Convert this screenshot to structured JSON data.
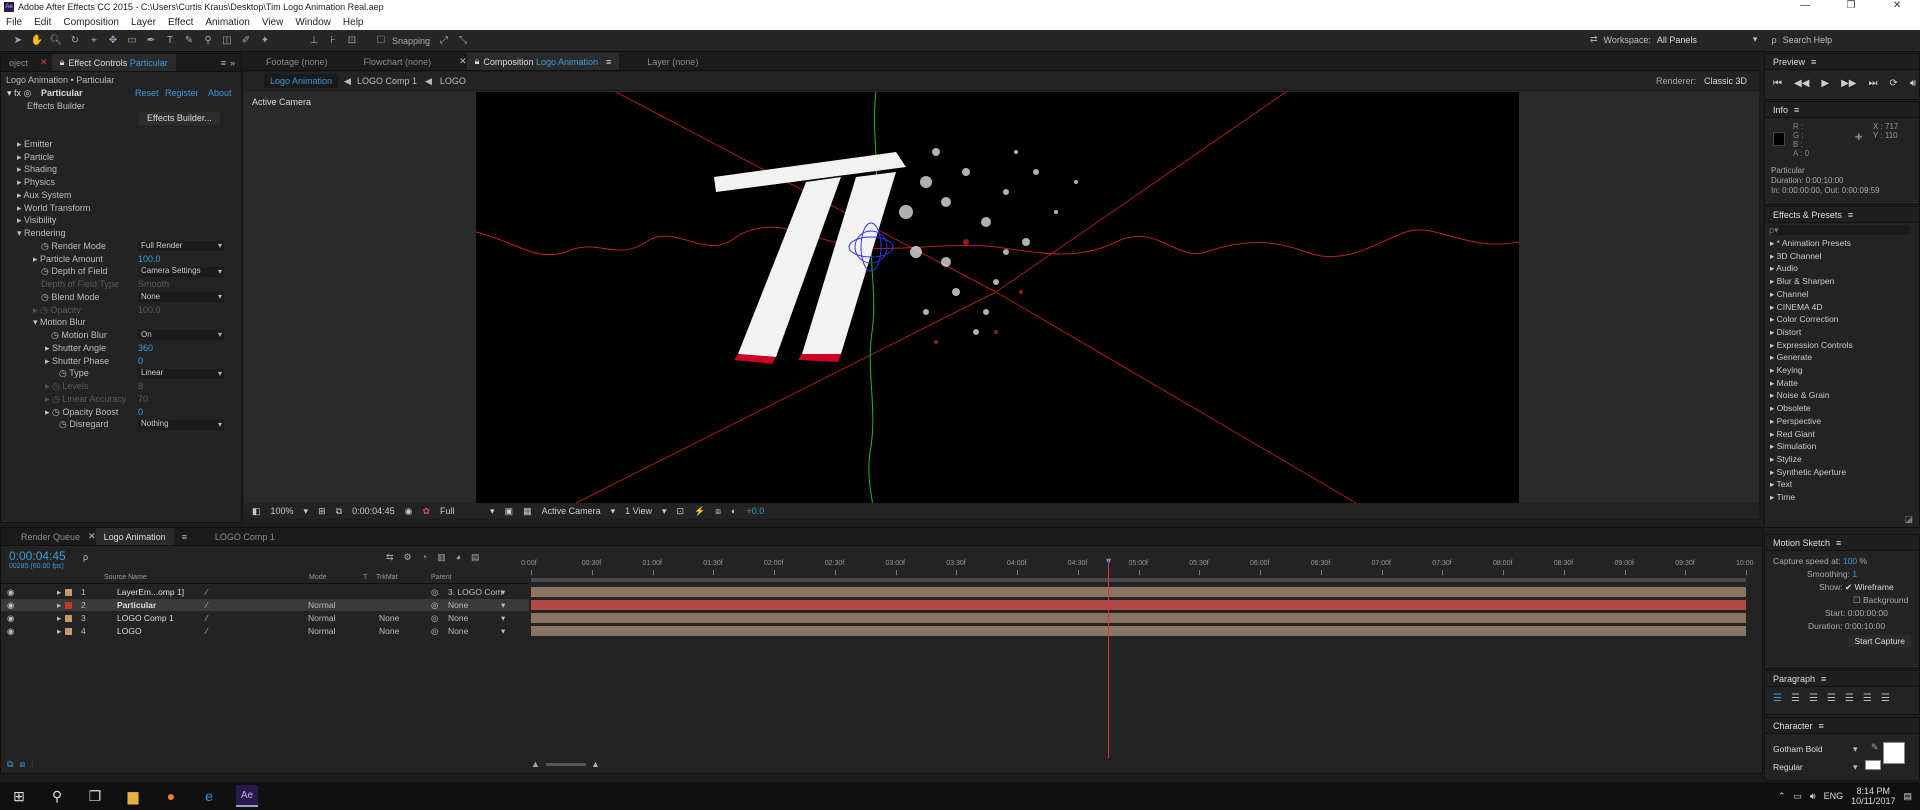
{
  "window": {
    "title": "Adobe After Effects CC 2015 - C:\\Users\\Curtis Kraus\\Desktop\\Tim Logo Animation Real.aep",
    "min": "—",
    "max": "❐",
    "close": "✕"
  },
  "menu": [
    "File",
    "Edit",
    "Composition",
    "Layer",
    "Effect",
    "Animation",
    "View",
    "Window",
    "Help"
  ],
  "toolbar": {
    "snapping": "Snapping",
    "workspace_label": "Workspace:",
    "workspace_value": "All Panels",
    "search_help": "Search Help"
  },
  "effect_controls": {
    "tabs": [
      "oject",
      "Effect Controls",
      "Particular"
    ],
    "breadcrumb": "Logo Animation • Particular",
    "effect_name": "Particular",
    "reset": "Reset",
    "register": "Register",
    "about": "About",
    "effects_builder_label": "Effects Builder",
    "effects_builder_btn": "Effects Builder...",
    "groups": [
      "Emitter",
      "Particle",
      "Shading",
      "Physics",
      "Aux System",
      "World Transform",
      "Visibility",
      "Rendering"
    ],
    "props": [
      {
        "label": "Render Mode",
        "value": "Full Render",
        "dd": true
      },
      {
        "label": "Particle Amount",
        "value": "100.0"
      },
      {
        "label": "Depth of Field",
        "value": "Camera Settings",
        "dd": true
      },
      {
        "label": "Depth of Field Type",
        "value": "Smooth",
        "dim": true
      },
      {
        "label": "Blend Mode",
        "value": "None",
        "dd": true
      },
      {
        "label": "Opacity",
        "value": "100.0",
        "dim": true
      },
      {
        "label": "Motion Blur",
        "value": ""
      },
      {
        "label": "Motion Blur",
        "value": "On",
        "dd": true
      },
      {
        "label": "Shutter Angle",
        "value": "360"
      },
      {
        "label": "Shutter Phase",
        "value": "0"
      },
      {
        "label": "Type",
        "value": "Linear",
        "dd": true
      },
      {
        "label": "Levels",
        "value": "8",
        "dim": true
      },
      {
        "label": "Linear Accuracy",
        "value": "70",
        "dim": true
      },
      {
        "label": "Opacity Boost",
        "value": "0"
      },
      {
        "label": "Disregard",
        "value": "Nothing",
        "dd": true
      }
    ]
  },
  "viewer_tabs": {
    "footage": "Footage (none)",
    "flowchart": "Flowchart (none)",
    "composition": "Composition",
    "composition_name": "Logo Animation",
    "layer": "Layer (none)"
  },
  "viewer": {
    "crumbs": [
      "Logo Animation",
      "LOGO Comp 1",
      "LOGO"
    ],
    "renderer_label": "Renderer:",
    "renderer_value": "Classic 3D",
    "active_camera": "Active Camera",
    "bottom": {
      "zoom": "100%",
      "time": "0:00:04:45",
      "resolution": "Full",
      "camera": "Active Camera",
      "views": "1 View",
      "exposure": "+0.0"
    }
  },
  "timeline": {
    "tabs": [
      "Render Queue",
      "Logo Animation",
      "LOGO Comp 1"
    ],
    "timecode": "0:00:04:45",
    "frame": "00285 (60.00 fps)",
    "headers": {
      "source": "Source Name",
      "mode": "Mode",
      "t": "T",
      "trkmat": "TrkMat",
      "parent": "Parent"
    },
    "ticks": [
      "0:00f",
      "00:30f",
      "01:00f",
      "01:30f",
      "02:00f",
      "02:30f",
      "03:00f",
      "03:30f",
      "04:00f",
      "04:30f",
      "05:00f",
      "05:30f",
      "06:00f",
      "06:30f",
      "07:00f",
      "07:30f",
      "08:00f",
      "08:30f",
      "09:00f",
      "09:30f",
      "10:00"
    ],
    "playhead_fraction": 0.475,
    "layers": [
      {
        "num": "1",
        "name": "LayerEm...omp 1]",
        "mode": "",
        "trkmat": "",
        "parent": "3. LOGO Com",
        "color": "#c49a6c"
      },
      {
        "num": "2",
        "name": "Particular",
        "mode": "Normal",
        "trkmat": "",
        "parent": "None",
        "color": "#c0392b"
      },
      {
        "num": "3",
        "name": "LOGO Comp 1",
        "mode": "Normal",
        "trkmat": "None",
        "parent": "None",
        "color": "#c49a6c"
      },
      {
        "num": "4",
        "name": "LOGO",
        "mode": "Normal",
        "trkmat": "None",
        "parent": "None",
        "color": "#c49a6c"
      }
    ]
  },
  "preview": {
    "title": "Preview"
  },
  "info": {
    "title": "Info",
    "r": "R :",
    "g": "G :",
    "b": "B :",
    "a": "A : 0",
    "x": "X : 717",
    "y": "Y : 110",
    "layer": "Particular",
    "duration": "Duration: 0:00:10:00",
    "inout": "In: 0:00:00:00, Out: 0:00:09:59"
  },
  "effects_presets": {
    "title": "Effects & Presets",
    "search_placeholder": "ρ▾",
    "items": [
      "* Animation Presets",
      "3D Channel",
      "Audio",
      "Blur & Sharpen",
      "Channel",
      "CINEMA 4D",
      "Color Correction",
      "Distort",
      "Expression Controls",
      "Generate",
      "Keying",
      "Matte",
      "Noise & Grain",
      "Obsolete",
      "Perspective",
      "Red Giant",
      "Simulation",
      "Stylize",
      "Synthetic Aperture",
      "Text",
      "Time"
    ]
  },
  "motion_sketch": {
    "title": "Motion Sketch",
    "capture_label": "Capture speed at:",
    "capture_value": "100",
    "capture_unit": "%",
    "smoothing_label": "Smoothing:",
    "smoothing_value": "1",
    "show_label": "Show:",
    "wireframe": "Wireframe",
    "background": "Background",
    "start_label": "Start:",
    "start_value": "0:00:00:00",
    "duration_label": "Duration:",
    "duration_value": "0:00:10:00",
    "start_capture": "Start Capture"
  },
  "paragraph": {
    "title": "Paragraph"
  },
  "character": {
    "title": "Character",
    "font": "Gotham Bold",
    "style": "Regular"
  },
  "taskbar": {
    "time": "8:14 PM",
    "date": "10/11/2017",
    "lang": "ENG"
  }
}
